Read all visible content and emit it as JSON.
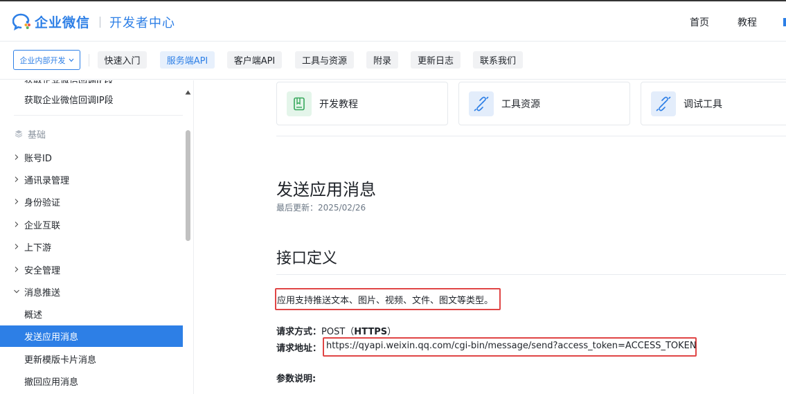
{
  "header": {
    "brand": "企业微信",
    "subtitle": "开发者中心",
    "nav": [
      "首页",
      "教程"
    ]
  },
  "subnav": {
    "dropdown": "企业内部开发",
    "tabs": [
      "快速入门",
      "服务端API",
      "客户端API",
      "工具与资源",
      "附录",
      "更新日志",
      "联系我们"
    ],
    "active_tab": "服务端API"
  },
  "sidebar": {
    "partial_item": "获取企业微信回调IP段",
    "section": "基础",
    "items": [
      {
        "label": "账号ID",
        "chevron": "right"
      },
      {
        "label": "通讯录管理",
        "chevron": "right"
      },
      {
        "label": "身份验证",
        "chevron": "right"
      },
      {
        "label": "企业互联",
        "chevron": "right"
      },
      {
        "label": "上下游",
        "chevron": "right"
      },
      {
        "label": "安全管理",
        "chevron": "right"
      },
      {
        "label": "消息推送",
        "chevron": "down"
      }
    ],
    "subitems": [
      "概述",
      "发送应用消息",
      "更新模版卡片消息",
      "撤回应用消息"
    ],
    "active_subitem": "发送应用消息"
  },
  "cards": [
    {
      "label": "开发教程",
      "icon": "book-icon"
    },
    {
      "label": "工具资源",
      "icon": "plug-icon"
    },
    {
      "label": "调试工具",
      "icon": "plug-icon"
    }
  ],
  "article": {
    "title": "发送应用消息",
    "updated": "最后更新：2025/02/26",
    "section_title": "接口定义",
    "intro": "应用支持推送文本、图片、视频、文件、图文等类型。",
    "method_label": "请求方式：",
    "method_value": "POST（",
    "method_bold": "HTTPS",
    "method_close": "）",
    "url_label": "请求地址：",
    "url": "https://qyapi.weixin.qq.com/cgi-bin/message/send?access_token=ACCESS_TOKEN",
    "params_label": "参数说明:"
  },
  "colors": {
    "accent": "#2d7fe6",
    "highlight": "#e04545"
  }
}
